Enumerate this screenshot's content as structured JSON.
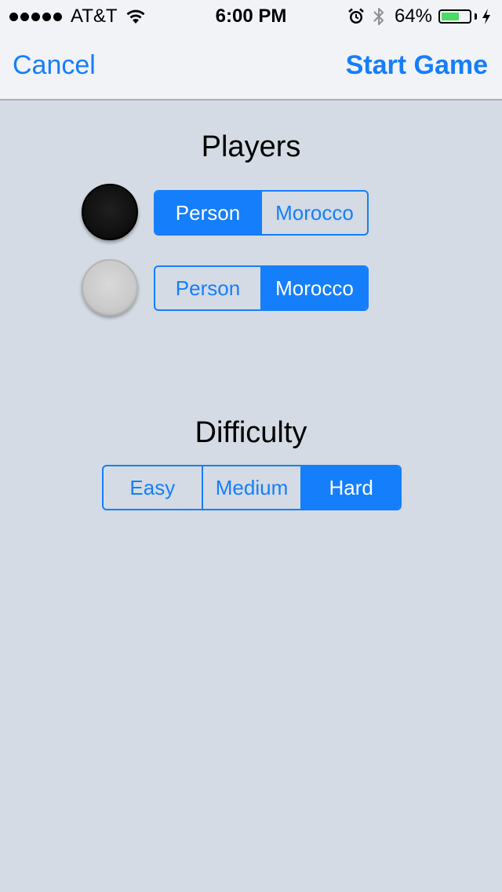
{
  "status_bar": {
    "signal_bars": 5,
    "carrier": "AT&T",
    "time": "6:00 PM",
    "battery_percent": "64%",
    "battery_level": 0.64,
    "icons": [
      "wifi-icon",
      "alarm-icon",
      "bluetooth-icon",
      "charging-icon"
    ],
    "battery_color": "#4cd964"
  },
  "nav": {
    "cancel_label": "Cancel",
    "start_label": "Start Game"
  },
  "players": {
    "title": "Players",
    "rows": [
      {
        "piece": "black-piece-icon",
        "options": [
          "Person",
          "Morocco"
        ],
        "selected": 0
      },
      {
        "piece": "white-piece-icon",
        "options": [
          "Person",
          "Morocco"
        ],
        "selected": 1
      }
    ]
  },
  "difficulty": {
    "title": "Difficulty",
    "options": [
      "Easy",
      "Medium",
      "Hard"
    ],
    "selected": 2
  },
  "colors": {
    "accent": "#157efb",
    "background": "#d4dbe4",
    "nav_background": "#f1f3f7"
  }
}
